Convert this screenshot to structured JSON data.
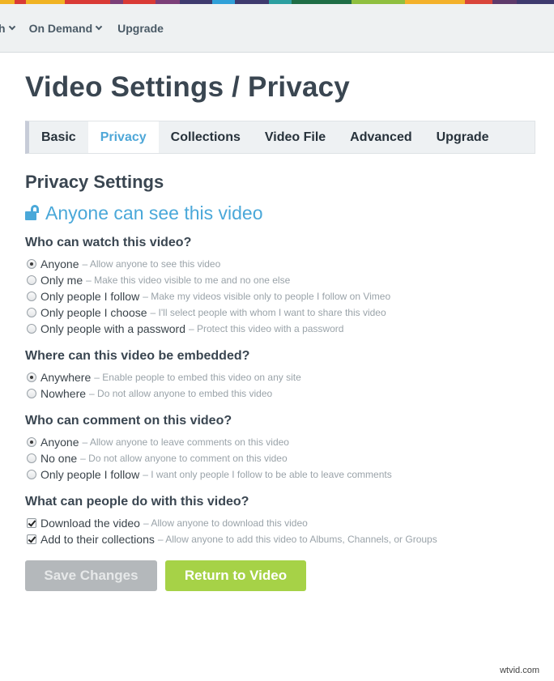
{
  "stripe_colors": [
    "#f0b323",
    "#d93a35",
    "#7b3f78",
    "#3e3a6e",
    "#2fa0d8",
    "#2b9fa0",
    "#1e6d45",
    "#8fbf3f",
    "#f3b12a",
    "#d9453a",
    "#5e3a6b"
  ],
  "topnav": {
    "items": [
      {
        "label": "h",
        "has_dropdown": true
      },
      {
        "label": "On Demand",
        "has_dropdown": true
      },
      {
        "label": "Upgrade",
        "has_dropdown": false
      }
    ]
  },
  "page": {
    "title": "Video Settings / Privacy"
  },
  "tabs": [
    {
      "label": "Basic",
      "active": false
    },
    {
      "label": "Privacy",
      "active": true
    },
    {
      "label": "Collections",
      "active": false
    },
    {
      "label": "Video File",
      "active": false
    },
    {
      "label": "Advanced",
      "active": false
    },
    {
      "label": "Upgrade",
      "active": false
    }
  ],
  "privacy": {
    "section_title": "Privacy Settings",
    "status_icon": "unlock-icon",
    "status_text": "Anyone can see this video",
    "accent_color": "#4aa8d9"
  },
  "groups": {
    "watch": {
      "title": "Who can watch this video?",
      "options": [
        {
          "label": "Anyone",
          "desc": "– Allow anyone to see this video",
          "checked": true
        },
        {
          "label": "Only me",
          "desc": "– Make this video visible to me and no one else",
          "checked": false
        },
        {
          "label": "Only people I follow",
          "desc": "– Make my videos visible only to people I follow on Vimeo",
          "checked": false
        },
        {
          "label": "Only people I choose",
          "desc": "– I'll select people with whom I want to share this video",
          "checked": false
        },
        {
          "label": "Only people with a password",
          "desc": "– Protect this video with a password",
          "checked": false
        }
      ]
    },
    "embed": {
      "title": "Where can this video be embedded?",
      "options": [
        {
          "label": "Anywhere",
          "desc": "– Enable people to embed this video on any site",
          "checked": true
        },
        {
          "label": "Nowhere",
          "desc": "– Do not allow anyone to embed this video",
          "checked": false
        }
      ]
    },
    "comment": {
      "title": "Who can comment on this video?",
      "options": [
        {
          "label": "Anyone",
          "desc": "– Allow anyone to leave comments on this video",
          "checked": true
        },
        {
          "label": "No one",
          "desc": "– Do not allow anyone to comment on this video",
          "checked": false
        },
        {
          "label": "Only people I follow",
          "desc": "– I want only people I follow to be able to leave comments",
          "checked": false
        }
      ]
    },
    "actions": {
      "title": "What can people do with this video?",
      "options": [
        {
          "label": "Download the video",
          "desc": "– Allow anyone to download this video",
          "checked": true
        },
        {
          "label": "Add to their collections",
          "desc": "– Allow anyone to add this video to Albums, Channels, or Groups",
          "checked": true
        }
      ]
    }
  },
  "buttons": {
    "save": "Save Changes",
    "return": "Return to Video",
    "save_color": "#b4b8bb",
    "return_color": "#a6d247"
  },
  "watermark": "wtvid.com"
}
